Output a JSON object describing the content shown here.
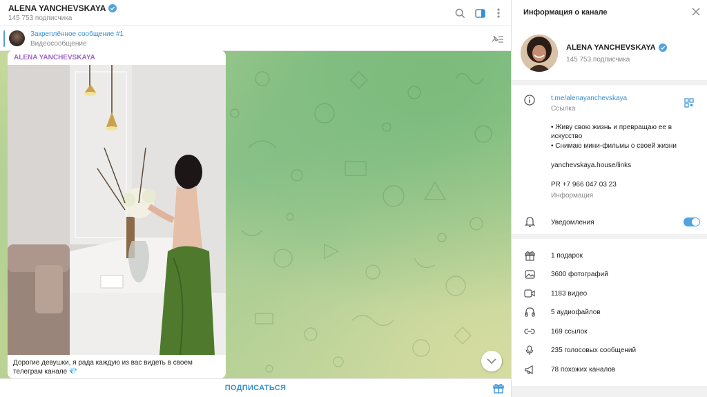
{
  "chat": {
    "title": "ALENA YANCHEVSKAYA",
    "subscribers": "145 753 подписчика",
    "pinned": {
      "title": "Закреплённое сообщение #1",
      "subtitle": "Видеосообщение"
    },
    "message": {
      "author": "ALENA YANCHEVSKAYA",
      "text": "Дорогие девушки, я рада каждую из вас видеть в своем телеграм канале 💎"
    },
    "subscribe_label": "ПОДПИСАТЬСЯ"
  },
  "panel": {
    "title": "Информация о канале",
    "channel_name": "ALENA YANCHEVSKAYA",
    "subscribers": "145 753 подписчика",
    "link": "t.me/alenayanchevskaya",
    "link_caption": "Ссылка",
    "info_line1": "• Живу свою жизнь и превращаю ее в искусство",
    "info_line2": "• Снимаю мини-фильмы о своей жизни",
    "info_link": "yanchevskaya.house/links",
    "info_pr": "PR +7 966 047 03 23",
    "info_caption": "Информация",
    "notifications_label": "Уведомления",
    "notifications_on": true,
    "stats": [
      {
        "icon": "gift-icon",
        "label": "1 подарок"
      },
      {
        "icon": "photo-icon",
        "label": "3600 фотографий"
      },
      {
        "icon": "video-icon",
        "label": "1183 видео"
      },
      {
        "icon": "headphones-icon",
        "label": "5 аудиофайлов"
      },
      {
        "icon": "link-icon",
        "label": "169 ссылок"
      },
      {
        "icon": "microphone-icon",
        "label": "235 голосовых сообщений"
      },
      {
        "icon": "megaphone-icon",
        "label": "78 похожих каналов"
      }
    ]
  },
  "colors": {
    "accent": "#3390d6",
    "author": "#a063c9",
    "verified": "#4fa3e0"
  }
}
